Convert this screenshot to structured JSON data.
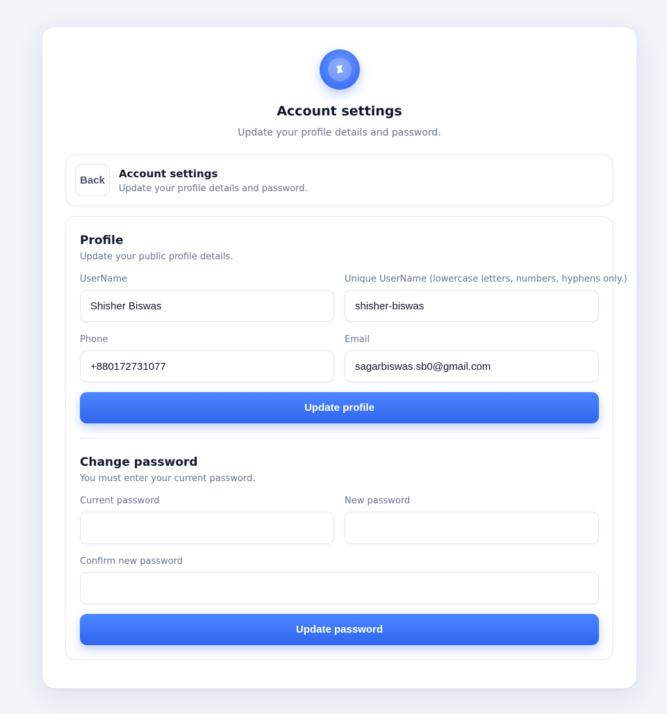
{
  "page": {
    "title": "Account settings",
    "subtitle": "Update your profile details and password."
  },
  "header": {
    "back_label": "Back",
    "title": "Account settings",
    "subtitle": "Update your profile details and password."
  },
  "profile": {
    "title": "Profile",
    "subtitle": "Update your public profile details.",
    "username_label": "UserName",
    "username_value": "Shisher Biswas",
    "unique_label": "Unique UserName (lowercase letters, numbers, hyphens only.)",
    "unique_value": "shisher-biswas",
    "phone_label": "Phone",
    "phone_value": "+880172731077",
    "email_label": "Email",
    "email_value": "sagarbiswas.sb0@gmail.com",
    "submit_label": "Update profile"
  },
  "password": {
    "title": "Change password",
    "subtitle": "You must enter your current password.",
    "current_label": "Current password",
    "new_label": "New password",
    "confirm_label": "Confirm new password",
    "submit_label": "Update password"
  },
  "icons": {
    "logo": "pin-icon"
  },
  "colors": {
    "accent": "#3b74f8",
    "background": "#f2f4fa"
  }
}
